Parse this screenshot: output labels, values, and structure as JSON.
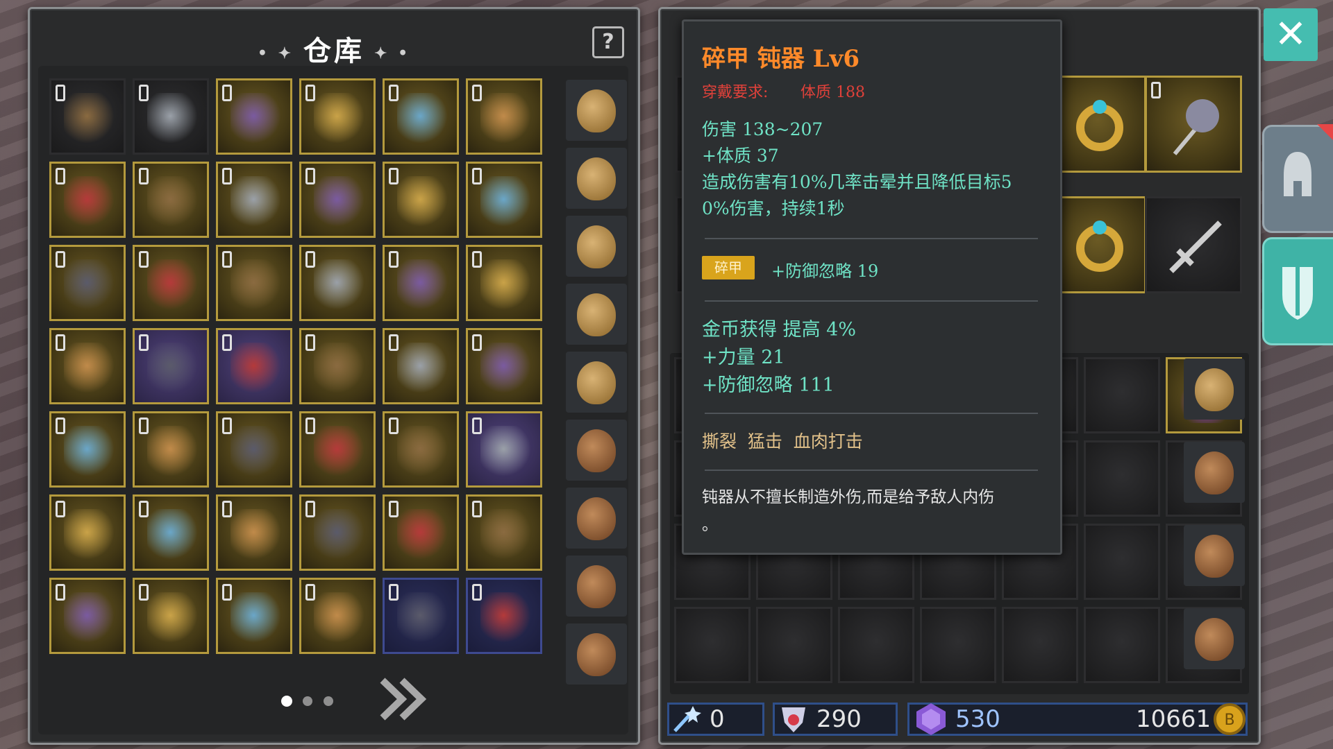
{
  "warehouse": {
    "title": "仓库",
    "help_label": "?",
    "page_count": 3,
    "current_page": 1,
    "next_page_label": "»"
  },
  "close_label": "✕",
  "tooltip": {
    "item_name": "碎甲 钝器 Lv6",
    "requirement_label": "穿戴要求:",
    "requirement_value": "体质 188",
    "damage": "伤害 138~207",
    "stat1": "+体质 37",
    "effect_line1": "造成伤害有10%几率击晕并且降低目标5",
    "effect_line2": "0%伤害，持续1秒",
    "badge": "碎甲",
    "badge_stat": "+防御忽略 19",
    "bonus1": "金币获得 提高 4%",
    "bonus2": "+力量 21",
    "bonus3": "+防御忽略 111",
    "skills": "撕裂  猛击  血肉打击",
    "desc_line1": "钝器从不擅长制造外伤,而是给予敌人内伤",
    "desc_line2": "。"
  },
  "currency": {
    "wand": "0",
    "gems": "290",
    "crystal": "530",
    "gold": "10661"
  },
  "colors": {
    "tooltip_title": "#ff8a2a",
    "requirement": "#e0413a",
    "stat_text": "#6fe3c6",
    "badge_bg": "#d9a41c",
    "skill_text": "#e3c28a",
    "desc_text": "#e6e6e6",
    "close_button": "#45bdb0"
  },
  "icons": {
    "help": "question-mark-icon",
    "close": "close-icon",
    "helmet_tab": "helmet-icon",
    "shield_tab": "shield-sword-icon",
    "wand": "magic-wand-icon",
    "gem": "red-gem-icon",
    "crystal": "purple-crystal-icon",
    "gold": "gold-coin-icon"
  }
}
